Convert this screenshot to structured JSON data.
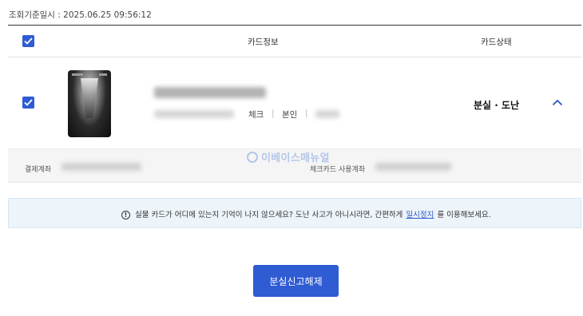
{
  "inquiry": {
    "label": "조회기준일시 : 2025.06.25 09:56:12"
  },
  "table": {
    "header": {
      "card_info": "카드정보",
      "card_status": "카드상태"
    },
    "row": {
      "card_type": "체크",
      "separator": "|",
      "owner": "본인",
      "status": "분실 · 도난",
      "selected": true
    },
    "detail": {
      "payment_account_label": "결제계좌",
      "check_card_account_label": "체크카드 사용계좌"
    }
  },
  "watermark": {
    "text": "이베이스매뉴얼"
  },
  "notice": {
    "icon": "!",
    "text_before": "실물 카드가 어디에 있는지 기억이 나지 않으세요? 도난 사고가 아니시라면, 간편하게",
    "link": "일시정지",
    "text_after": "를 이용해보세요."
  },
  "actions": {
    "release_button": "분실신고해제"
  },
  "colors": {
    "accent": "#2f5bd3",
    "notice_bg": "#edf4fa",
    "detail_bg": "#f5f5f5"
  },
  "icons": [
    "checkbox-checked-icon",
    "chevron-up-icon",
    "info-circle-icon"
  ]
}
